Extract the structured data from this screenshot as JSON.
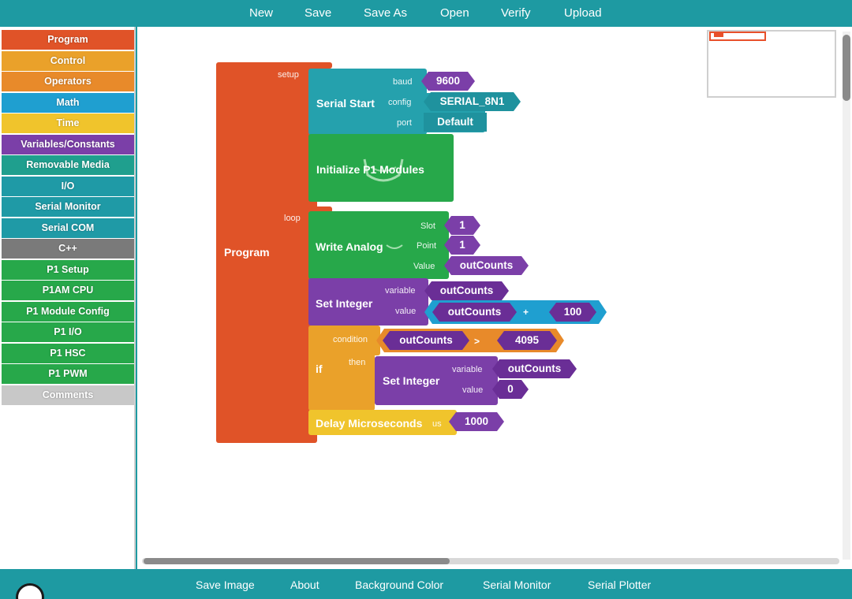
{
  "menu_top": [
    "New",
    "Save",
    "Save As",
    "Open",
    "Verify",
    "Upload"
  ],
  "menu_bottom": [
    "Save Image",
    "About",
    "Background Color",
    "Serial Monitor",
    "Serial Plotter"
  ],
  "categories": [
    {
      "label": "Program",
      "color": "#e05328"
    },
    {
      "label": "Control",
      "color": "#eaa12a"
    },
    {
      "label": "Operators",
      "color": "#e88a2a"
    },
    {
      "label": "Math",
      "color": "#1f9fd0"
    },
    {
      "label": "Time",
      "color": "#f0c42c"
    },
    {
      "label": "Variables/Constants",
      "color": "#7b3fa8"
    },
    {
      "label": "Removable Media",
      "color": "#1f9f8e"
    },
    {
      "label": "I/O",
      "color": "#1f9aa6"
    },
    {
      "label": "Serial Monitor",
      "color": "#1f9aa6"
    },
    {
      "label": "Serial COM",
      "color": "#1f9aa6"
    },
    {
      "label": "C++",
      "color": "#7a7a7a"
    },
    {
      "label": "P1 Setup",
      "color": "#27a84a"
    },
    {
      "label": "P1AM CPU",
      "color": "#27a84a"
    },
    {
      "label": "P1 Module Config",
      "color": "#27a84a"
    },
    {
      "label": "P1 I/O",
      "color": "#27a84a"
    },
    {
      "label": "P1 HSC",
      "color": "#27a84a"
    },
    {
      "label": "P1 PWM",
      "color": "#27a84a"
    },
    {
      "label": "Comments",
      "color": "#c8c8c8"
    }
  ],
  "program": {
    "title": "Program",
    "setup_label": "setup",
    "loop_label": "loop",
    "serial_start": {
      "title": "Serial Start",
      "baud_label": "baud",
      "baud": "9600",
      "config_label": "config",
      "config": "SERIAL_8N1",
      "port_label": "port",
      "port": "Default"
    },
    "init_modules": {
      "title": "Initialize P1 Modules"
    },
    "write_analog": {
      "title": "Write Analog",
      "slot_label": "Slot",
      "slot": "1",
      "point_label": "Point",
      "point": "1",
      "value_label": "Value",
      "value": "outCounts"
    },
    "set_integer_1": {
      "title": "Set Integer",
      "variable_label": "variable",
      "variable": "outCounts",
      "value_label": "value",
      "left": "outCounts",
      "op": "+",
      "right": "100"
    },
    "if_block": {
      "title": "if",
      "condition_label": "condition",
      "left": "outCounts",
      "op": ">",
      "right": "4095",
      "then_label": "then",
      "set_integer": {
        "title": "Set Integer",
        "variable_label": "variable",
        "variable": "outCounts",
        "value_label": "value",
        "value": "0"
      }
    },
    "delay": {
      "title": "Delay Microseconds",
      "unit_label": "us",
      "value": "1000"
    }
  },
  "colors": {
    "chrome": "#1e9aa2",
    "program": "#e05328",
    "serial": "#25a1ad",
    "p1": "#27a84a",
    "variables": "#7b3fa8",
    "math": "#1f9fd0",
    "control": "#eaa12a",
    "time": "#f0c42c"
  }
}
